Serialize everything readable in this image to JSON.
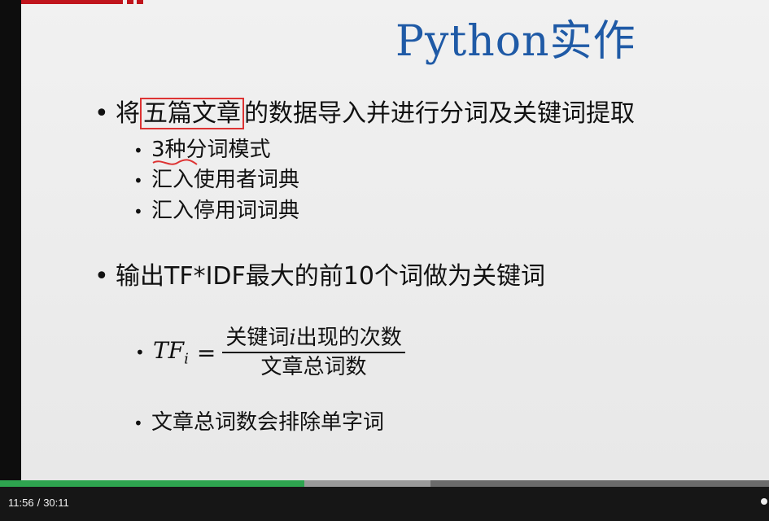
{
  "slide": {
    "title": "Python实作",
    "bullet1": {
      "prefix": "将",
      "boxed": "五篇文章",
      "suffix": "的数据导入并进行分词及关键词提取",
      "subitems": [
        "3种分词模式",
        "汇入使用者词典",
        "汇入停用词词典"
      ]
    },
    "bullet2": "输出TF*IDF最大的前10个词做为关键词",
    "formula": {
      "lhs": "TF",
      "subscript": "i",
      "equals": "=",
      "numerator_a": "关键词",
      "numerator_var": "i",
      "numerator_b": "出现的次数",
      "denominator": "文章总词数"
    },
    "note": "文章总词数会排除单字词"
  },
  "player": {
    "current_time": "11:56",
    "separator": "/",
    "duration": "30:11",
    "progress_fraction": 0.396,
    "buffer_fraction": 0.56,
    "colors": {
      "played": "#2ea44f",
      "buffered": "#9a9a9a",
      "track": "#6b6b6b"
    }
  }
}
